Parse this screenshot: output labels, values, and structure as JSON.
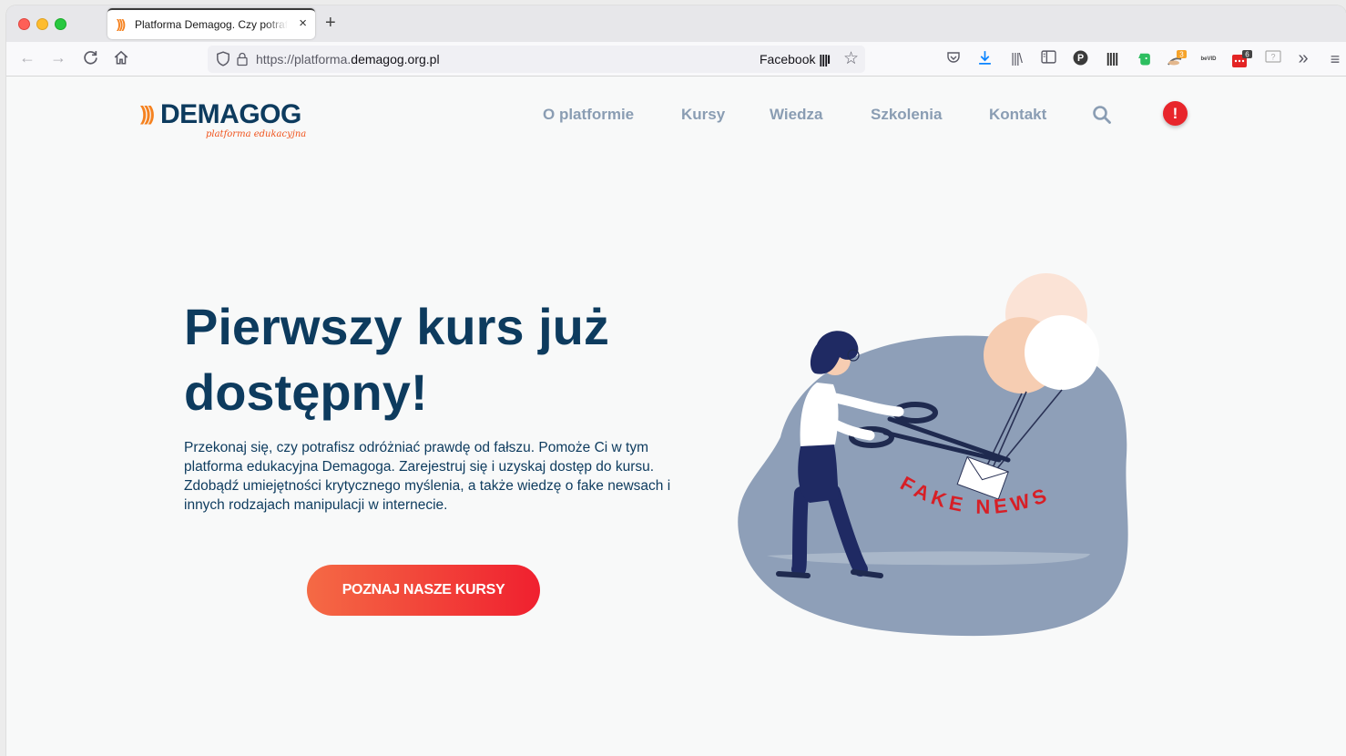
{
  "browser": {
    "tab_title": "Platforma Demagog. Czy potrafisz",
    "tab_close": "×",
    "new_tab": "+",
    "url_prefix": "https://platforma.",
    "url_domain": "demagog.org.pl",
    "url_right": "Facebook",
    "back": "←",
    "forward": "→",
    "reload": "C",
    "home": "⌂",
    "star": "☆",
    "overflow": "»",
    "menu": "≡",
    "badge_orange": "3",
    "badge_dark": "6"
  },
  "site": {
    "logo_wave": ")))",
    "logo": "DEMAGOG",
    "logo_sub": "platforma edukacyjna",
    "menu": [
      "O platformie",
      "Kursy",
      "Wiedza",
      "Szkolenia",
      "Kontakt"
    ],
    "alert_glyph": "!"
  },
  "hero": {
    "title_line1": "Pierwszy kurs już",
    "title_line2": "dostępny!",
    "lead": "Przekonaj się, czy potrafisz odróżniać prawdę od fałszu. Pomoże Ci w tym platforma edukacyjna Demagoga. Zarejestruj się i uzyskaj dostęp do kursu. Zdobądź umiejętności krytycznego myślenia, a także wiedzę o fake newsach i innych rodzajach manipulacji w internecie.",
    "cta": "POZNAJ NASZE KURSY",
    "illustration_text": "FAKE NEWS"
  },
  "colors": {
    "navy": "#0d3b5e",
    "orange": "#f58220",
    "red": "#f0202f",
    "menu": "#8a9db3",
    "blob": "#8e9fb8"
  }
}
